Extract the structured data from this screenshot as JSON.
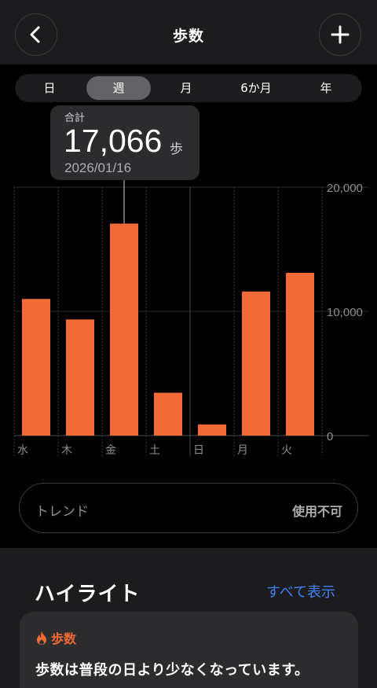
{
  "header": {
    "title": "歩数"
  },
  "segments": [
    "日",
    "週",
    "月",
    "6か月",
    "年"
  ],
  "selected_segment": "週",
  "tooltip": {
    "label": "合計",
    "value": "17,066",
    "unit": "歩",
    "date": "2026/01/16"
  },
  "chart_data": {
    "type": "bar",
    "categories": [
      "水",
      "木",
      "金",
      "土",
      "日",
      "月",
      "火"
    ],
    "values": [
      11000,
      9350,
      17066,
      3450,
      900,
      11600,
      13100
    ],
    "selected_index": 2,
    "ylim": [
      0,
      20000
    ],
    "yticks": [
      0,
      10000,
      20000
    ],
    "ytick_labels": [
      "0",
      "10,000",
      "20,000"
    ],
    "bar_color": "#f26a35"
  },
  "trend": {
    "label": "トレンド",
    "value": "使用不可"
  },
  "highlights": {
    "title": "ハイライト",
    "show_all": "すべて表示",
    "card": {
      "category": "歩数",
      "text": "歩数は普段の日より少なくなっています。"
    }
  }
}
